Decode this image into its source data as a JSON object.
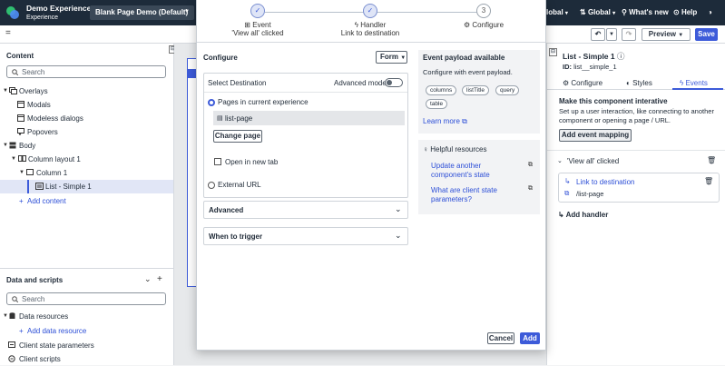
{
  "topbar": {
    "app_title": "Demo Experience",
    "app_subtitle": "Experience",
    "page_selector": "Blank Page Demo (Default)",
    "locale": "Global",
    "region": "Global",
    "whats_new": "What's new",
    "help": "Help",
    "locale_prefix": "lobal"
  },
  "toolbar": {
    "preview_label": "Preview",
    "save_label": "Save",
    "menu_glyph": "="
  },
  "left": {
    "content_title": "Content",
    "search_placeholder": "Search",
    "tree": [
      {
        "label": "Overlays"
      },
      {
        "label": "Modals"
      },
      {
        "label": "Modeless dialogs"
      },
      {
        "label": "Popovers"
      },
      {
        "label": "Body"
      },
      {
        "label": "Column layout 1"
      },
      {
        "label": "Column 1"
      },
      {
        "label": "List - Simple 1"
      },
      {
        "label": "Add content"
      }
    ],
    "data_title": "Data and scripts",
    "data_search_placeholder": "Search",
    "data_tree": [
      {
        "label": "Data resources"
      },
      {
        "label": "Add data resource"
      },
      {
        "label": "Client state parameters"
      },
      {
        "label": "Client scripts"
      }
    ]
  },
  "modal": {
    "steps": [
      {
        "label": "Event",
        "sub": "'View all' clicked"
      },
      {
        "label": "Handler",
        "sub": "Link to destination"
      },
      {
        "number": "3",
        "label": "Configure"
      }
    ],
    "configure_title": "Configure",
    "form_select": "Form",
    "select_destination": "Select Destination",
    "advanced_mode": "Advanced mode",
    "pages_option": "Pages in current experience",
    "page_value": "list-page",
    "change_page": "Change page",
    "open_new_tab": "Open in new tab",
    "external_url": "External URL",
    "advanced": "Advanced",
    "when_to_trigger": "When to trigger",
    "payload_title": "Event payload available",
    "payload_desc": "Configure with event payload.",
    "payload_pills": [
      "columns",
      "listTitle",
      "query",
      "table"
    ],
    "learn_more": "Learn more",
    "helpful_title": "Helpful resources",
    "helpful_links": [
      "Update another component's state",
      "What are client state parameters?"
    ],
    "cancel": "Cancel",
    "add": "Add"
  },
  "right": {
    "component_title": "List - Simple 1",
    "component_id_label": "ID:",
    "component_id": "list__simple_1",
    "tabs": [
      "Configure",
      "Styles",
      "Events"
    ],
    "active_tab": "Events",
    "interactive_title": "Make this component interative",
    "interactive_desc": "Set up a user interaction, like connecting to another component or opening a page / URL.",
    "add_event_mapping": "Add event mapping",
    "event_name": "'View all' clicked",
    "handler_name": "Link to destination",
    "handler_target": "/list-page",
    "add_handler": "Add handler"
  },
  "colors": {
    "accent": "#3d5bd9",
    "topbar": "#1d2b3a"
  }
}
